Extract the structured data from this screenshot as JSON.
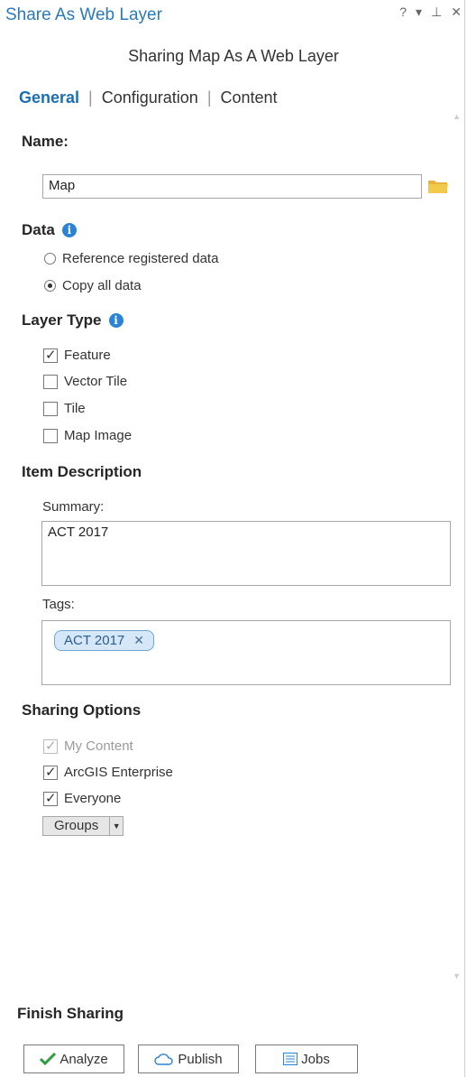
{
  "window": {
    "title": "Share As Web Layer",
    "controls": {
      "help": "?",
      "menu": "▾",
      "pin": "⊥",
      "close": "✕"
    }
  },
  "subtitle": "Sharing Map As A Web Layer",
  "tabs": [
    {
      "label": "General",
      "active": true
    },
    {
      "label": "Configuration",
      "active": false
    },
    {
      "label": "Content",
      "active": false
    }
  ],
  "name_section": {
    "label": "Name:",
    "value": "Map"
  },
  "data_section": {
    "label": "Data",
    "options": [
      {
        "label": "Reference registered data",
        "selected": false
      },
      {
        "label": "Copy all data",
        "selected": true
      }
    ]
  },
  "layer_type": {
    "label": "Layer Type",
    "options": [
      {
        "label": "Feature",
        "checked": true
      },
      {
        "label": "Vector Tile",
        "checked": false
      },
      {
        "label": "Tile",
        "checked": false
      },
      {
        "label": "Map Image",
        "checked": false
      }
    ]
  },
  "item_description": {
    "label": "Item Description",
    "summary_label": "Summary:",
    "summary_value": "ACT 2017",
    "tags_label": "Tags:",
    "tags": [
      "ACT 2017"
    ]
  },
  "sharing_options": {
    "label": "Sharing Options",
    "options": [
      {
        "label": "My Content",
        "checked": true,
        "disabled": true
      },
      {
        "label": "ArcGIS Enterprise",
        "checked": true,
        "disabled": false
      },
      {
        "label": "Everyone",
        "checked": true,
        "disabled": false
      }
    ],
    "groups_button": "Groups"
  },
  "finish": {
    "label": "Finish Sharing",
    "analyze": "Analyze",
    "publish": "Publish",
    "jobs": "Jobs"
  },
  "colors": {
    "accent": "#1b6fb4",
    "title": "#2a7ab8",
    "info": "#2a83d4",
    "check_green": "#2e9e3e"
  }
}
